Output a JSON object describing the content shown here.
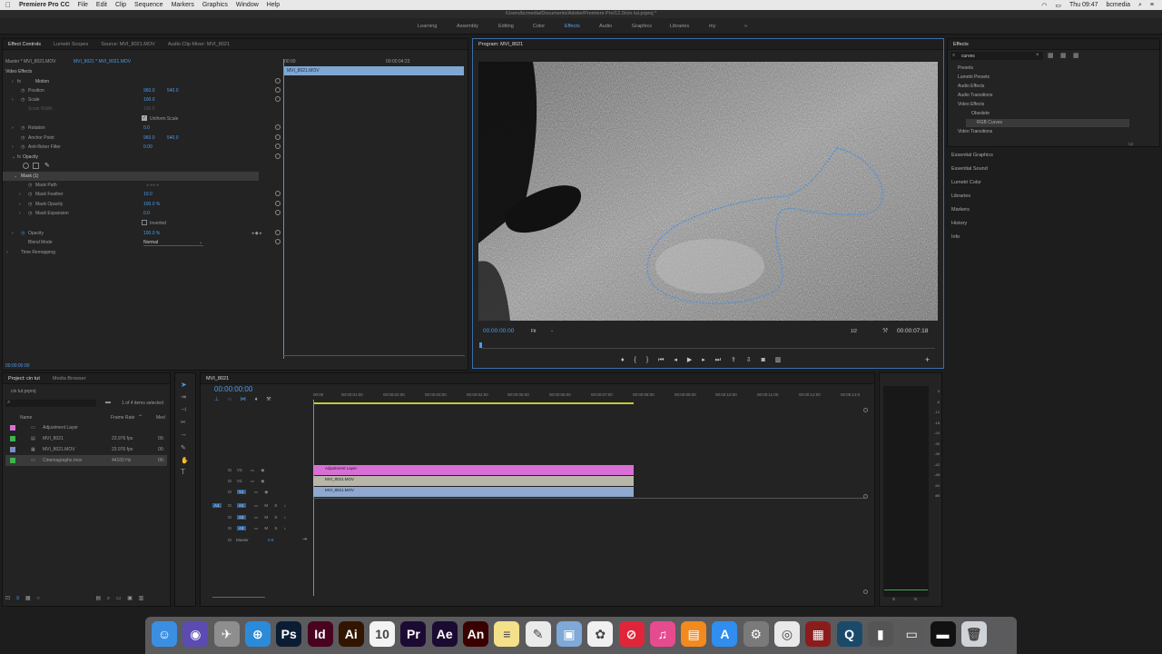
{
  "menubar": {
    "app_name": "Premiere Pro CC",
    "items": [
      "File",
      "Edit",
      "Clip",
      "Sequence",
      "Markers",
      "Graphics",
      "Window",
      "Help"
    ],
    "clock": "Thu 09:47",
    "user": "bcmedia"
  },
  "window": {
    "path": "/Users/bcmedia/Documents/Adobe/Premiere Pro/12.0/cin tut.prproj *"
  },
  "workspaces": [
    "Learning",
    "Assembly",
    "Editing",
    "Color",
    "Effects",
    "Audio",
    "Graphics",
    "Libraries",
    "my",
    "»"
  ],
  "effect_controls": {
    "tabs": [
      "Effect Controls",
      "Lumetri Scopes",
      "Source: MVI_8021.MOV",
      "Audio Clip Mixer: MVI_8021"
    ],
    "master": "Master * MVI_8021.MOV",
    "sequence": "MVI_8021 * MVI_8021.MOV",
    "section": "Video Effects",
    "timecode_start": "00:00",
    "timecode_end": "00:00:04:23",
    "clip_bar": "MVI_8021.MOV",
    "motion": "Motion",
    "position_label": "Position",
    "position_x": "960.0",
    "position_y": "540.0",
    "scale_label": "Scale",
    "scale_val": "100.0",
    "scale_width_label": "Scale Width",
    "scale_width_val": "100.0",
    "uniform_scale": "Uniform Scale",
    "rotation_label": "Rotation",
    "rotation_val": "0.0",
    "anchor_label": "Anchor Point",
    "anchor_x": "960.0",
    "anchor_y": "540.0",
    "antiflicker_label": "Anti-flicker Filter",
    "antiflicker_val": "0.00",
    "opacity_group": "Opacity",
    "mask_label": "Mask (1)",
    "mask_path": "Mask Path",
    "mask_feather_label": "Mask Feather",
    "mask_feather_val": "10.0",
    "mask_opacity_label": "Mask Opacity",
    "mask_opacity_val": "100.0 %",
    "mask_expansion_label": "Mask Expansion",
    "mask_expansion_val": "0.0",
    "inverted": "Inverted",
    "opacity_label": "Opacity",
    "opacity_val": "100.0 %",
    "blend_label": "Blend Mode",
    "blend_val": "Normal",
    "time_remap": "Time Remapping",
    "bottom_timecode": "00:00:00:00"
  },
  "program": {
    "title": "Program: MVI_8021",
    "timecode": "00:00:00:00",
    "fit": "Fit",
    "quality": "1/2",
    "duration": "00:00:07:18"
  },
  "effects_panel": {
    "title": "Effects",
    "search": "curves",
    "tree": [
      "Presets",
      "Lumetri Presets",
      "Audio Effects",
      "Audio Transitions",
      "Video Effects",
      "Obsolete",
      "RGB Curves",
      "Video Transitions"
    ],
    "side_panels": [
      "Essential Graphics",
      "Essential Sound",
      "Lumetri Color",
      "Libraries",
      "Markers",
      "History",
      "Info"
    ]
  },
  "project": {
    "tabs": [
      "Project: cin tut",
      "Media Browser"
    ],
    "file": "cin tut.prproj",
    "selection": "1 of 4 items selected",
    "col_name": "Name",
    "col_rate": "Frame Rate",
    "col_media": "Med",
    "items": [
      {
        "name": "Adjustment Layer",
        "rate": "",
        "color": "#d86fd6"
      },
      {
        "name": "MVI_8021",
        "rate": "23.976 fps",
        "color": "#3fb34f"
      },
      {
        "name": "MVI_8021.MOV",
        "rate": "23.976 fps",
        "color": "#7a8dc9"
      },
      {
        "name": "Cinemagraphs.mov",
        "rate": "44100 Hz",
        "color": "#3fb34f"
      }
    ]
  },
  "timeline": {
    "tab": "MVI_8021",
    "timecode": "00:00:00:00",
    "ticks": [
      "00:00",
      "00:00:01:00",
      "00:00:02:00",
      "00:00:03:00",
      "00:00:04:00",
      "00:00:05:00",
      "00:00:06:00",
      "00:00:07:00",
      "00:00:08:00",
      "00:00:09:00",
      "00:00:10:00",
      "00:00:11:00",
      "00:00:12:00",
      "00:00:13:0"
    ],
    "video_tracks": [
      "V3",
      "V2",
      "V1"
    ],
    "audio_tracks": [
      "A1",
      "A2",
      "A3"
    ],
    "master": "Master",
    "master_val": "0.0",
    "clips": {
      "adjustment": "Adjustment Layer",
      "v2": "MVI_8021.MOV",
      "v1": "MVI_8021.MOV"
    },
    "meter_labels": [
      "0",
      "-6",
      "-12",
      "-18",
      "-24",
      "-30",
      "-36",
      "-42",
      "-48",
      "-54",
      "dB"
    ],
    "meter_bottom": [
      "S",
      "S"
    ]
  },
  "dock": {
    "apps": [
      {
        "name": "Finder",
        "glyph": "☺",
        "color": "#3b8fe3"
      },
      {
        "name": "Siri",
        "glyph": "◉",
        "color": "#5b4bb3"
      },
      {
        "name": "Launchpad",
        "glyph": "✈",
        "color": "#8e8e8e"
      },
      {
        "name": "Safari",
        "glyph": "⊕",
        "color": "#2c8bd9"
      },
      {
        "name": "Photoshop",
        "glyph": "Ps",
        "color": "#0a1d33"
      },
      {
        "name": "InDesign",
        "glyph": "Id",
        "color": "#49021f"
      },
      {
        "name": "Illustrator",
        "glyph": "Ai",
        "color": "#321500"
      },
      {
        "name": "Calendar",
        "glyph": "10",
        "color": "#f3f3f3"
      },
      {
        "name": "Premiere",
        "glyph": "Pr",
        "color": "#1d0a33"
      },
      {
        "name": "After Effects",
        "glyph": "Ae",
        "color": "#1b0b33"
      },
      {
        "name": "Animate",
        "glyph": "An",
        "color": "#3a0000"
      },
      {
        "name": "Notes",
        "glyph": "≡",
        "color": "#f5e08a"
      },
      {
        "name": "TextEdit",
        "glyph": "✎",
        "color": "#eaeaea"
      },
      {
        "name": "Preview",
        "glyph": "▣",
        "color": "#7fa9d6"
      },
      {
        "name": "Photos",
        "glyph": "✿",
        "color": "#f0f0f0"
      },
      {
        "name": "News",
        "glyph": "⊘",
        "color": "#e0253a"
      },
      {
        "name": "iTunes",
        "glyph": "♫",
        "color": "#e64b8f"
      },
      {
        "name": "iBooks",
        "glyph": "▤",
        "color": "#f28a1e"
      },
      {
        "name": "App Store",
        "glyph": "A",
        "color": "#2f8ef0"
      },
      {
        "name": "System Preferences",
        "glyph": "⚙",
        "color": "#7a7a7a"
      },
      {
        "name": "Chrome",
        "glyph": "◎",
        "color": "#e9e9e9"
      },
      {
        "name": "Photo Booth",
        "glyph": "▦",
        "color": "#8b1c1c"
      },
      {
        "name": "QuickTime",
        "glyph": "Q",
        "color": "#1a4a6a"
      },
      {
        "name": "Utilities",
        "glyph": "▮",
        "color": "#555555"
      },
      {
        "name": "Downloads",
        "glyph": "▭",
        "color": "#5a5a5a"
      },
      {
        "name": "Terminal",
        "glyph": "▬",
        "color": "#111111"
      },
      {
        "name": "Trash",
        "glyph": "🗑",
        "color": "#cfd3d8"
      }
    ]
  }
}
